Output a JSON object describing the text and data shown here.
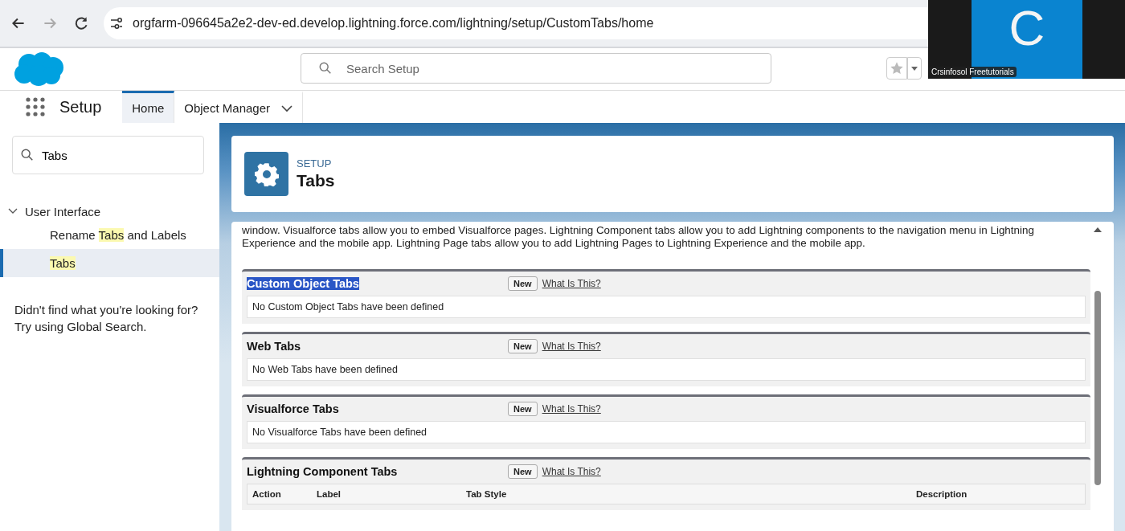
{
  "browser": {
    "url": "orgfarm-096645a2e2-dev-ed.develop.lightning.force.com/lightning/setup/CustomTabs/home"
  },
  "video_overlay": {
    "avatar_letter": "C",
    "caption": "Crsinfosol Freetutorials"
  },
  "header": {
    "search": {
      "placeholder": "Search Setup"
    }
  },
  "nav": {
    "app_name": "Setup",
    "tabs": [
      {
        "label": "Home",
        "selected": true,
        "dropdown": false
      },
      {
        "label": "Object Manager",
        "selected": false,
        "dropdown": true
      }
    ]
  },
  "sidebar": {
    "search": {
      "value": "Tabs"
    },
    "tree": [
      {
        "label": "User Interface",
        "expanded": true,
        "children": [
          {
            "parts": [
              {
                "text": "Rename ",
                "highlighted": false
              },
              {
                "text": "Tabs",
                "highlighted": true
              },
              {
                "text": " and Labels",
                "highlighted": false
              }
            ],
            "selected": false
          },
          {
            "parts": [
              {
                "text": "Tabs",
                "highlighted": true
              }
            ],
            "selected": true
          }
        ]
      }
    ],
    "help_text": "Didn't find what you're looking for? Try using Global Search."
  },
  "page_header": {
    "eyebrow": "SETUP",
    "title": "Tabs"
  },
  "content": {
    "intro": "window. Visualforce tabs allow you to embed Visualforce pages. Lightning Component tabs allow you to add Lightning components to the navigation menu in Lightning Experience and the mobile app. Lightning Page tabs allow you to add Lightning Pages to Lightning Experience and the mobile app.",
    "sections": [
      {
        "title": "Custom Object Tabs",
        "title_selected": true,
        "new_button": "New",
        "help_link": "What Is This?",
        "kind": "empty",
        "message": "No Custom Object Tabs have been defined"
      },
      {
        "title": "Web Tabs",
        "title_selected": false,
        "new_button": "New",
        "help_link": "What Is This?",
        "kind": "empty",
        "message": "No Web Tabs have been defined"
      },
      {
        "title": "Visualforce Tabs",
        "title_selected": false,
        "new_button": "New",
        "help_link": "What Is This?",
        "kind": "empty",
        "message": "No Visualforce Tabs have been defined"
      },
      {
        "title": "Lightning Component Tabs",
        "title_selected": false,
        "new_button": "New",
        "help_link": "What Is This?",
        "kind": "table",
        "columns": [
          "Action",
          "Label",
          "Tab Style",
          "Description"
        ]
      }
    ]
  }
}
